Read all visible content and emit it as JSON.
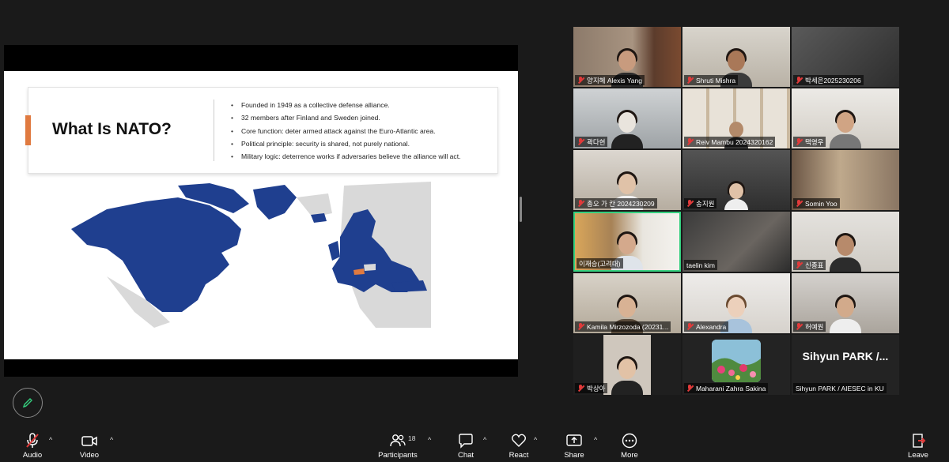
{
  "slide": {
    "title": "What Is NATO?",
    "bullets": [
      "Founded in 1949 as a collective defense alliance.",
      "32 members after Finland and Sweden joined.",
      "Core function: deter armed attack against the Euro-Atlantic area.",
      "Political principle: security is shared, not purely national.",
      "Military logic: deterrence works if adversaries believe the alliance will act."
    ]
  },
  "gallery": {
    "tiles": [
      {
        "name": "양지혜 Alexis Yang",
        "muted": true
      },
      {
        "name": "Shruti Mishra",
        "muted": true
      },
      {
        "name": "박세은2025230206",
        "muted": true
      },
      {
        "name": "곽다현",
        "muted": true
      },
      {
        "name": "Reiv Mambu 2024320162",
        "muted": true
      },
      {
        "name": "택영우",
        "muted": true
      },
      {
        "name": "총오 가 칸 2024230209",
        "muted": true
      },
      {
        "name": "송지원",
        "muted": true
      },
      {
        "name": "Somin Yoo",
        "muted": true
      },
      {
        "name": "이재승(고려대)",
        "muted": false
      },
      {
        "name": "taelin kim",
        "muted": false
      },
      {
        "name": "신종표",
        "muted": true
      },
      {
        "name": "Kamila Mirzozoda (20231...",
        "muted": true
      },
      {
        "name": "Alexandra",
        "muted": true
      },
      {
        "name": "허예원",
        "muted": true
      },
      {
        "name": "박상아",
        "muted": true
      },
      {
        "name": "Maharani Zahra Sakina",
        "muted": true
      },
      {
        "name": "Sihyun PARK / AIESEC in KU",
        "muted": false,
        "display_name": "Sihyun PARK /..."
      }
    ]
  },
  "toolbar": {
    "audio": "Audio",
    "video": "Video",
    "participants": "Participants",
    "participants_count": "18",
    "chat": "Chat",
    "react": "React",
    "share": "Share",
    "more": "More",
    "leave": "Leave"
  },
  "colors": {
    "accent": "#e07a40",
    "nato_blue": "#1f3f8f",
    "active_speaker": "#35d07f",
    "muted_red": "#e03a3a"
  }
}
